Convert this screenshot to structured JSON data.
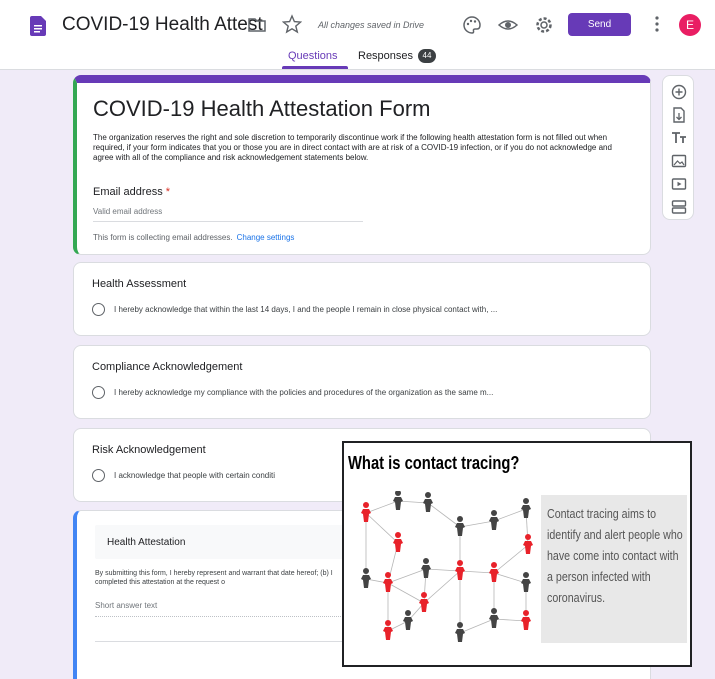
{
  "header": {
    "title": "COVID-19 Health Attest",
    "saved_status": "All changes saved in Drive",
    "send_label": "Send",
    "avatar_letter": "E",
    "tabs": [
      {
        "label": "Questions"
      },
      {
        "label": "Responses",
        "badge": "44"
      }
    ],
    "accent_color": "#673ab7",
    "avatar_color": "#e91e63"
  },
  "form": {
    "title": "COVID-19 Health Attestation Form",
    "description": "The organization reserves the right and sole discretion to temporarily discontinue work if the following health attestation form is not filled out when required, if your form indicates that you or those you are in direct contact with are at risk of a COVID-19 infection, or if you do not acknowledge and agree with all of the compliance and risk acknowledgement statements below.",
    "email_label": "Email address",
    "required_mark": "*",
    "email_placeholder": "Valid email address",
    "collecting_notice": "This form is collecting email addresses.",
    "change_settings": "Change settings"
  },
  "questions": [
    {
      "title": "Health Assessment",
      "option": "I hereby acknowledge that within the last 14 days, I and the people I remain in close physical contact with, ..."
    },
    {
      "title": "Compliance Acknowledgement",
      "option": "I hereby acknowledge my compliance with the policies and procedures of the organization as the same m..."
    },
    {
      "title": "Risk Acknowledgement",
      "option": "I acknowledge that people with certain conditi"
    }
  ],
  "last_section": {
    "title": "Health Attestation",
    "description": "By submitting this form, I hereby represent and warrant that date hereof; (b) I completed this attestation at the request o",
    "short_answer": "Short answer text"
  },
  "toolbar": [
    "add-question-icon",
    "import-questions-icon",
    "add-title-icon",
    "add-image-icon",
    "add-video-icon",
    "add-section-icon"
  ],
  "overlay": {
    "title": "What is contact tracing?",
    "text": "Contact tracing aims to identify and alert people who have come into contact with a person infected with coronavirus.",
    "infected_color": "#e8222a",
    "healthy_color": "#444444"
  }
}
